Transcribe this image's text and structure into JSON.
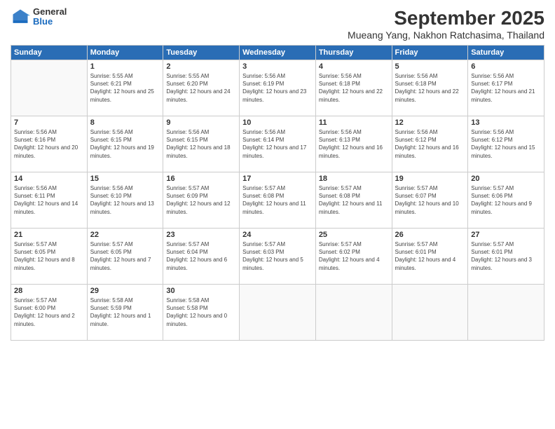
{
  "logo": {
    "general": "General",
    "blue": "Blue"
  },
  "title": "September 2025",
  "location": "Mueang Yang, Nakhon Ratchasima, Thailand",
  "days_of_week": [
    "Sunday",
    "Monday",
    "Tuesday",
    "Wednesday",
    "Thursday",
    "Friday",
    "Saturday"
  ],
  "weeks": [
    [
      {
        "day": "",
        "sunrise": "",
        "sunset": "",
        "daylight": ""
      },
      {
        "day": "1",
        "sunrise": "Sunrise: 5:55 AM",
        "sunset": "Sunset: 6:21 PM",
        "daylight": "Daylight: 12 hours and 25 minutes."
      },
      {
        "day": "2",
        "sunrise": "Sunrise: 5:55 AM",
        "sunset": "Sunset: 6:20 PM",
        "daylight": "Daylight: 12 hours and 24 minutes."
      },
      {
        "day": "3",
        "sunrise": "Sunrise: 5:56 AM",
        "sunset": "Sunset: 6:19 PM",
        "daylight": "Daylight: 12 hours and 23 minutes."
      },
      {
        "day": "4",
        "sunrise": "Sunrise: 5:56 AM",
        "sunset": "Sunset: 6:18 PM",
        "daylight": "Daylight: 12 hours and 22 minutes."
      },
      {
        "day": "5",
        "sunrise": "Sunrise: 5:56 AM",
        "sunset": "Sunset: 6:18 PM",
        "daylight": "Daylight: 12 hours and 22 minutes."
      },
      {
        "day": "6",
        "sunrise": "Sunrise: 5:56 AM",
        "sunset": "Sunset: 6:17 PM",
        "daylight": "Daylight: 12 hours and 21 minutes."
      }
    ],
    [
      {
        "day": "7",
        "sunrise": "Sunrise: 5:56 AM",
        "sunset": "Sunset: 6:16 PM",
        "daylight": "Daylight: 12 hours and 20 minutes."
      },
      {
        "day": "8",
        "sunrise": "Sunrise: 5:56 AM",
        "sunset": "Sunset: 6:15 PM",
        "daylight": "Daylight: 12 hours and 19 minutes."
      },
      {
        "day": "9",
        "sunrise": "Sunrise: 5:56 AM",
        "sunset": "Sunset: 6:15 PM",
        "daylight": "Daylight: 12 hours and 18 minutes."
      },
      {
        "day": "10",
        "sunrise": "Sunrise: 5:56 AM",
        "sunset": "Sunset: 6:14 PM",
        "daylight": "Daylight: 12 hours and 17 minutes."
      },
      {
        "day": "11",
        "sunrise": "Sunrise: 5:56 AM",
        "sunset": "Sunset: 6:13 PM",
        "daylight": "Daylight: 12 hours and 16 minutes."
      },
      {
        "day": "12",
        "sunrise": "Sunrise: 5:56 AM",
        "sunset": "Sunset: 6:12 PM",
        "daylight": "Daylight: 12 hours and 16 minutes."
      },
      {
        "day": "13",
        "sunrise": "Sunrise: 5:56 AM",
        "sunset": "Sunset: 6:12 PM",
        "daylight": "Daylight: 12 hours and 15 minutes."
      }
    ],
    [
      {
        "day": "14",
        "sunrise": "Sunrise: 5:56 AM",
        "sunset": "Sunset: 6:11 PM",
        "daylight": "Daylight: 12 hours and 14 minutes."
      },
      {
        "day": "15",
        "sunrise": "Sunrise: 5:56 AM",
        "sunset": "Sunset: 6:10 PM",
        "daylight": "Daylight: 12 hours and 13 minutes."
      },
      {
        "day": "16",
        "sunrise": "Sunrise: 5:57 AM",
        "sunset": "Sunset: 6:09 PM",
        "daylight": "Daylight: 12 hours and 12 minutes."
      },
      {
        "day": "17",
        "sunrise": "Sunrise: 5:57 AM",
        "sunset": "Sunset: 6:08 PM",
        "daylight": "Daylight: 12 hours and 11 minutes."
      },
      {
        "day": "18",
        "sunrise": "Sunrise: 5:57 AM",
        "sunset": "Sunset: 6:08 PM",
        "daylight": "Daylight: 12 hours and 11 minutes."
      },
      {
        "day": "19",
        "sunrise": "Sunrise: 5:57 AM",
        "sunset": "Sunset: 6:07 PM",
        "daylight": "Daylight: 12 hours and 10 minutes."
      },
      {
        "day": "20",
        "sunrise": "Sunrise: 5:57 AM",
        "sunset": "Sunset: 6:06 PM",
        "daylight": "Daylight: 12 hours and 9 minutes."
      }
    ],
    [
      {
        "day": "21",
        "sunrise": "Sunrise: 5:57 AM",
        "sunset": "Sunset: 6:05 PM",
        "daylight": "Daylight: 12 hours and 8 minutes."
      },
      {
        "day": "22",
        "sunrise": "Sunrise: 5:57 AM",
        "sunset": "Sunset: 6:05 PM",
        "daylight": "Daylight: 12 hours and 7 minutes."
      },
      {
        "day": "23",
        "sunrise": "Sunrise: 5:57 AM",
        "sunset": "Sunset: 6:04 PM",
        "daylight": "Daylight: 12 hours and 6 minutes."
      },
      {
        "day": "24",
        "sunrise": "Sunrise: 5:57 AM",
        "sunset": "Sunset: 6:03 PM",
        "daylight": "Daylight: 12 hours and 5 minutes."
      },
      {
        "day": "25",
        "sunrise": "Sunrise: 5:57 AM",
        "sunset": "Sunset: 6:02 PM",
        "daylight": "Daylight: 12 hours and 4 minutes."
      },
      {
        "day": "26",
        "sunrise": "Sunrise: 5:57 AM",
        "sunset": "Sunset: 6:01 PM",
        "daylight": "Daylight: 12 hours and 4 minutes."
      },
      {
        "day": "27",
        "sunrise": "Sunrise: 5:57 AM",
        "sunset": "Sunset: 6:01 PM",
        "daylight": "Daylight: 12 hours and 3 minutes."
      }
    ],
    [
      {
        "day": "28",
        "sunrise": "Sunrise: 5:57 AM",
        "sunset": "Sunset: 6:00 PM",
        "daylight": "Daylight: 12 hours and 2 minutes."
      },
      {
        "day": "29",
        "sunrise": "Sunrise: 5:58 AM",
        "sunset": "Sunset: 5:59 PM",
        "daylight": "Daylight: 12 hours and 1 minute."
      },
      {
        "day": "30",
        "sunrise": "Sunrise: 5:58 AM",
        "sunset": "Sunset: 5:58 PM",
        "daylight": "Daylight: 12 hours and 0 minutes."
      },
      {
        "day": "",
        "sunrise": "",
        "sunset": "",
        "daylight": ""
      },
      {
        "day": "",
        "sunrise": "",
        "sunset": "",
        "daylight": ""
      },
      {
        "day": "",
        "sunrise": "",
        "sunset": "",
        "daylight": ""
      },
      {
        "day": "",
        "sunrise": "",
        "sunset": "",
        "daylight": ""
      }
    ]
  ]
}
